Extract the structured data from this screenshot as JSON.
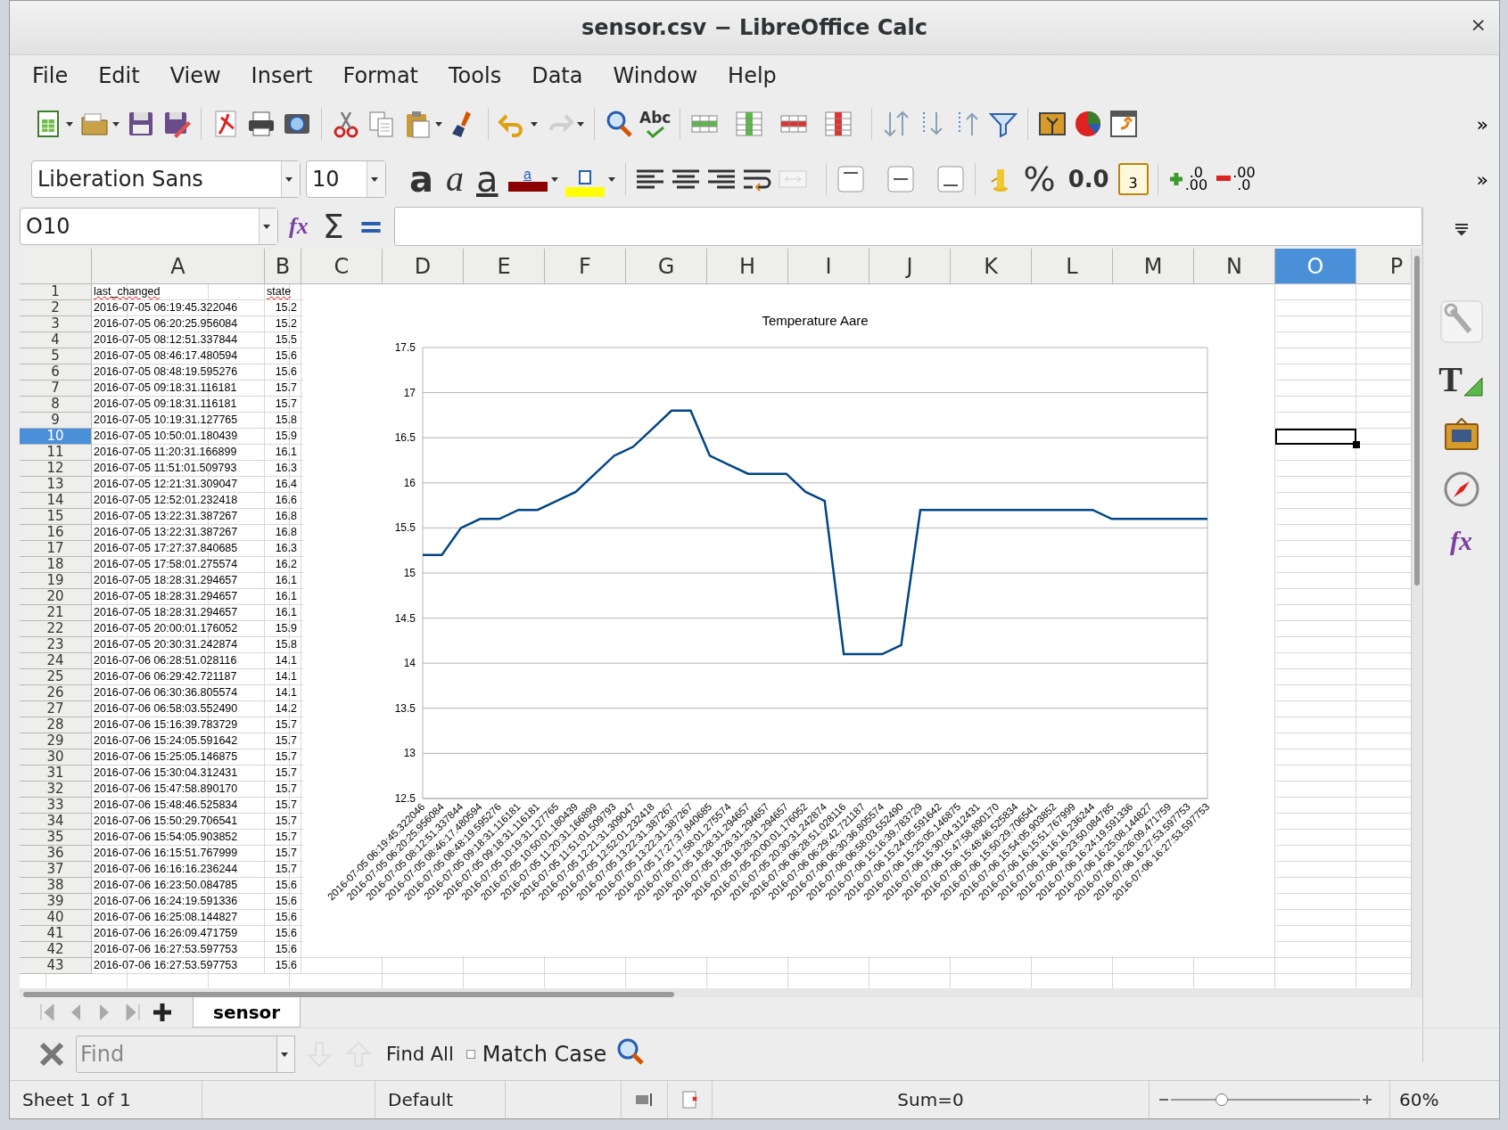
{
  "window": {
    "title": "sensor.csv − LibreOffice Calc",
    "close_label": "×"
  },
  "menu": [
    {
      "label": "File"
    },
    {
      "label": "Edit"
    },
    {
      "label": "View"
    },
    {
      "label": "Insert"
    },
    {
      "label": "Format"
    },
    {
      "label": "Tools"
    },
    {
      "label": "Data"
    },
    {
      "label": "Window"
    },
    {
      "label": "Help"
    }
  ],
  "standard_toolbar": {
    "spellcheck_label": "Abc",
    "overflow_label": "»"
  },
  "format_toolbar": {
    "font_name": "Liberation Sans",
    "font_size": "10",
    "style_letters": [
      {
        "label": "a",
        "kind": "bold"
      },
      {
        "label": "a",
        "kind": "italic"
      },
      {
        "label": "a",
        "kind": "underline"
      }
    ],
    "font_color_letter": "a",
    "percent": "%",
    "number_format": "0.0",
    "date_label": "3",
    "add_decimal": [
      ".0",
      ".00"
    ],
    "delete_decimal": [
      ".00",
      ".0"
    ],
    "overflow_label": "»"
  },
  "formula_bar": {
    "name_box": "O10",
    "function_label": "fx",
    "sum_label": "Σ",
    "formula_label": "="
  },
  "columns": [
    {
      "label": "A",
      "selected": false
    },
    {
      "label": "B",
      "selected": false
    },
    {
      "label": "C",
      "selected": false
    },
    {
      "label": "D",
      "selected": false
    },
    {
      "label": "E",
      "selected": false
    },
    {
      "label": "F",
      "selected": false
    },
    {
      "label": "G",
      "selected": false
    },
    {
      "label": "H",
      "selected": false
    },
    {
      "label": "I",
      "selected": false
    },
    {
      "label": "J",
      "selected": false
    },
    {
      "label": "K",
      "selected": false
    },
    {
      "label": "L",
      "selected": false
    },
    {
      "label": "M",
      "selected": false
    },
    {
      "label": "N",
      "selected": false
    },
    {
      "label": "O",
      "selected": true
    },
    {
      "label": "P",
      "selected": false
    }
  ],
  "header_row": {
    "number": "1",
    "selected": false,
    "cells": [
      {
        "text": "last_changed",
        "misspelled": true
      },
      {
        "text": "state",
        "misspelled": true
      }
    ]
  },
  "rows": [
    {
      "number": "2",
      "last_changed": "2016-07-05 06:19:45.322046",
      "state": "15.2",
      "selected": false
    },
    {
      "number": "3",
      "last_changed": "2016-07-05 06:20:25.956084",
      "state": "15.2",
      "selected": false
    },
    {
      "number": "4",
      "last_changed": "2016-07-05 08:12:51.337844",
      "state": "15.5",
      "selected": false
    },
    {
      "number": "5",
      "last_changed": "2016-07-05 08:46:17.480594",
      "state": "15.6",
      "selected": false
    },
    {
      "number": "6",
      "last_changed": "2016-07-05 08:48:19.595276",
      "state": "15.6",
      "selected": false
    },
    {
      "number": "7",
      "last_changed": "2016-07-05 09:18:31.116181",
      "state": "15.7",
      "selected": false
    },
    {
      "number": "8",
      "last_changed": "2016-07-05 09:18:31.116181",
      "state": "15.7",
      "selected": false
    },
    {
      "number": "9",
      "last_changed": "2016-07-05 10:19:31.127765",
      "state": "15.8",
      "selected": false
    },
    {
      "number": "10",
      "last_changed": "2016-07-05 10:50:01.180439",
      "state": "15.9",
      "selected": true
    },
    {
      "number": "11",
      "last_changed": "2016-07-05 11:20:31.166899",
      "state": "16.1",
      "selected": false
    },
    {
      "number": "12",
      "last_changed": "2016-07-05 11:51:01.509793",
      "state": "16.3",
      "selected": false
    },
    {
      "number": "13",
      "last_changed": "2016-07-05 12:21:31.309047",
      "state": "16.4",
      "selected": false
    },
    {
      "number": "14",
      "last_changed": "2016-07-05 12:52:01.232418",
      "state": "16.6",
      "selected": false
    },
    {
      "number": "15",
      "last_changed": "2016-07-05 13:22:31.387267",
      "state": "16.8",
      "selected": false
    },
    {
      "number": "16",
      "last_changed": "2016-07-05 13:22:31.387267",
      "state": "16.8",
      "selected": false
    },
    {
      "number": "17",
      "last_changed": "2016-07-05 17:27:37.840685",
      "state": "16.3",
      "selected": false
    },
    {
      "number": "18",
      "last_changed": "2016-07-05 17:58:01.275574",
      "state": "16.2",
      "selected": false
    },
    {
      "number": "19",
      "last_changed": "2016-07-05 18:28:31.294657",
      "state": "16.1",
      "selected": false
    },
    {
      "number": "20",
      "last_changed": "2016-07-05 18:28:31.294657",
      "state": "16.1",
      "selected": false
    },
    {
      "number": "21",
      "last_changed": "2016-07-05 18:28:31.294657",
      "state": "16.1",
      "selected": false
    },
    {
      "number": "22",
      "last_changed": "2016-07-05 20:00:01.176052",
      "state": "15.9",
      "selected": false
    },
    {
      "number": "23",
      "last_changed": "2016-07-05 20:30:31.242874",
      "state": "15.8",
      "selected": false
    },
    {
      "number": "24",
      "last_changed": "2016-07-06 06:28:51.028116",
      "state": "14.1",
      "selected": false
    },
    {
      "number": "25",
      "last_changed": "2016-07-06 06:29:42.721187",
      "state": "14.1",
      "selected": false
    },
    {
      "number": "26",
      "last_changed": "2016-07-06 06:30:36.805574",
      "state": "14.1",
      "selected": false
    },
    {
      "number": "27",
      "last_changed": "2016-07-06 06:58:03.552490",
      "state": "14.2",
      "selected": false
    },
    {
      "number": "28",
      "last_changed": "2016-07-06 15:16:39.783729",
      "state": "15.7",
      "selected": false
    },
    {
      "number": "29",
      "last_changed": "2016-07-06 15:24:05.591642",
      "state": "15.7",
      "selected": false
    },
    {
      "number": "30",
      "last_changed": "2016-07-06 15:25:05.146875",
      "state": "15.7",
      "selected": false
    },
    {
      "number": "31",
      "last_changed": "2016-07-06 15:30:04.312431",
      "state": "15.7",
      "selected": false
    },
    {
      "number": "32",
      "last_changed": "2016-07-06 15:47:58.890170",
      "state": "15.7",
      "selected": false
    },
    {
      "number": "33",
      "last_changed": "2016-07-06 15:48:46.525834",
      "state": "15.7",
      "selected": false
    },
    {
      "number": "34",
      "last_changed": "2016-07-06 15:50:29.706541",
      "state": "15.7",
      "selected": false
    },
    {
      "number": "35",
      "last_changed": "2016-07-06 15:54:05.903852",
      "state": "15.7",
      "selected": false
    },
    {
      "number": "36",
      "last_changed": "2016-07-06 16:15:51.767999",
      "state": "15.7",
      "selected": false
    },
    {
      "number": "37",
      "last_changed": "2016-07-06 16:16:16.236244",
      "state": "15.7",
      "selected": false
    },
    {
      "number": "38",
      "last_changed": "2016-07-06 16:23:50.084785",
      "state": "15.6",
      "selected": false
    },
    {
      "number": "39",
      "last_changed": "2016-07-06 16:24:19.591336",
      "state": "15.6",
      "selected": false
    },
    {
      "number": "40",
      "last_changed": "2016-07-06 16:25:08.144827",
      "state": "15.6",
      "selected": false
    },
    {
      "number": "41",
      "last_changed": "2016-07-06 16:26:09.471759",
      "state": "15.6",
      "selected": false
    },
    {
      "number": "42",
      "last_changed": "2016-07-06 16:27:53.597753",
      "state": "15.6",
      "selected": false
    },
    {
      "number": "43",
      "last_changed": "2016-07-06 16:27:53.597753",
      "state": "15.6",
      "selected": false
    }
  ],
  "chart": {
    "chart_data": {
      "type": "line",
      "title": "Temperature Aare",
      "categories": [
        "2016-07-05 06:19:45.322046",
        "2016-07-05 06:20:25.956084",
        "2016-07-05 08:12:51.337844",
        "2016-07-05 08:46:17.480594",
        "2016-07-05 08:48:19.595276",
        "2016-07-05 09:18:31.116181",
        "2016-07-05 09:18:31.116181",
        "2016-07-05 10:19:31.127765",
        "2016-07-05 10:50:01.180439",
        "2016-07-05 11:20:31.166899",
        "2016-07-05 11:51:01.509793",
        "2016-07-05 12:21:31.309047",
        "2016-07-05 12:52:01.232418",
        "2016-07-05 13:22:31.387267",
        "2016-07-05 13:22:31.387267",
        "2016-07-05 17:27:37.840685",
        "2016-07-05 17:58:01.275574",
        "2016-07-05 18:28:31.294657",
        "2016-07-05 18:28:31.294657",
        "2016-07-05 18:28:31.294657",
        "2016-07-05 20:00:01.176052",
        "2016-07-05 20:30:31.242874",
        "2016-07-06 06:28:51.028116",
        "2016-07-06 06:29:42.721187",
        "2016-07-06 06:30:36.805574",
        "2016-07-06 06:58:03.552490",
        "2016-07-06 15:16:39.783729",
        "2016-07-06 15:24:05.591642",
        "2016-07-06 15:25:05.146875",
        "2016-07-06 15:30:04.312431",
        "2016-07-06 15:47:58.890170",
        "2016-07-06 15:48:46.525834",
        "2016-07-06 15:50:29.706541",
        "2016-07-06 15:54:05.903852",
        "2016-07-06 16:15:51.767999",
        "2016-07-06 16:16:16.236244",
        "2016-07-06 16:23:50.084785",
        "2016-07-06 16:24:19.591336",
        "2016-07-06 16:25:08.144827",
        "2016-07-06 16:26:09.471759",
        "2016-07-06 16:27:53.597753",
        "2016-07-06 16:27:53.597753"
      ],
      "series": [
        {
          "color": "#004586",
          "values": [
            15.2,
            15.2,
            15.5,
            15.6,
            15.6,
            15.7,
            15.7,
            15.8,
            15.9,
            16.1,
            16.3,
            16.4,
            16.6,
            16.8,
            16.8,
            16.3,
            16.2,
            16.1,
            16.1,
            16.1,
            15.9,
            15.8,
            14.1,
            14.1,
            14.1,
            14.2,
            15.7,
            15.7,
            15.7,
            15.7,
            15.7,
            15.7,
            15.7,
            15.7,
            15.7,
            15.7,
            15.6,
            15.6,
            15.6,
            15.6,
            15.6,
            15.6
          ]
        }
      ],
      "grid": true,
      "ylim": [
        12.5,
        17.5
      ],
      "yticks": [
        12.5,
        13,
        13.5,
        14,
        14.5,
        15,
        15.5,
        16,
        16.5,
        17,
        17.5
      ]
    }
  },
  "sheet_tabs": [
    {
      "label": "sensor",
      "selected": true
    }
  ],
  "find_bar": {
    "placeholder": "Find",
    "find_all": "Find All",
    "match_case": {
      "label": "Match Case",
      "checked": false
    }
  },
  "sidebar": {
    "styles_label": "T",
    "functions_label": "fx"
  },
  "status_bar": {
    "sheet": "Sheet 1 of 1",
    "page_style": "Default",
    "sum": "Sum=0",
    "zoom": {
      "level": 0.27,
      "label": "60%"
    }
  }
}
